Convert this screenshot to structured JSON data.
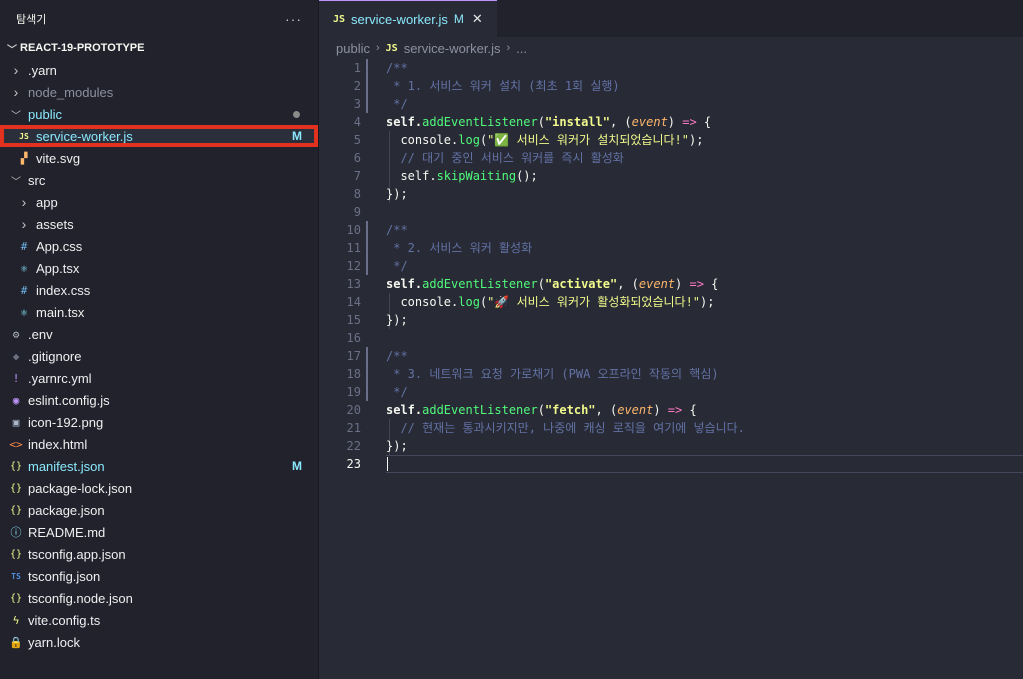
{
  "explorer": {
    "title": "탐색기",
    "more_label": "···",
    "project": "REACT-19-PROTOTYPE",
    "items": [
      {
        "label": ".yarn",
        "kind": "folder-closed",
        "depth": 0
      },
      {
        "label": "node_modules",
        "kind": "folder-closed",
        "depth": 0,
        "dim": true
      },
      {
        "label": "public",
        "kind": "folder-open",
        "depth": 0,
        "modified": true,
        "dot": true
      },
      {
        "label": "service-worker.js",
        "kind": "js",
        "icon": "JS",
        "depth": 1,
        "modified": true,
        "selected": true,
        "badge": "M"
      },
      {
        "label": "vite.svg",
        "kind": "svg",
        "icon": "▞",
        "depth": 1
      },
      {
        "label": "src",
        "kind": "folder-open",
        "depth": 0
      },
      {
        "label": "app",
        "kind": "folder-closed",
        "depth": 1
      },
      {
        "label": "assets",
        "kind": "folder-closed",
        "depth": 1
      },
      {
        "label": "App.css",
        "kind": "css",
        "icon": "#",
        "depth": 1
      },
      {
        "label": "App.tsx",
        "kind": "react",
        "icon": "⚛",
        "depth": 1
      },
      {
        "label": "index.css",
        "kind": "css",
        "icon": "#",
        "depth": 1
      },
      {
        "label": "main.tsx",
        "kind": "react",
        "icon": "⚛",
        "depth": 1
      },
      {
        "label": ".env",
        "kind": "gear",
        "icon": "⚙",
        "depth": 0
      },
      {
        "label": ".gitignore",
        "kind": "git",
        "icon": "◆",
        "depth": 0
      },
      {
        "label": ".yarnrc.yml",
        "kind": "yaml",
        "icon": "!",
        "depth": 0
      },
      {
        "label": "eslint.config.js",
        "kind": "eslint",
        "icon": "◉",
        "depth": 0
      },
      {
        "label": "icon-192.png",
        "kind": "image",
        "icon": "▣",
        "depth": 0
      },
      {
        "label": "index.html",
        "kind": "html",
        "icon": "<>",
        "depth": 0
      },
      {
        "label": "manifest.json",
        "kind": "json",
        "icon": "{}",
        "depth": 0,
        "modified": true,
        "badge": "M"
      },
      {
        "label": "package-lock.json",
        "kind": "json",
        "icon": "{}",
        "depth": 0
      },
      {
        "label": "package.json",
        "kind": "json",
        "icon": "{}",
        "depth": 0
      },
      {
        "label": "README.md",
        "kind": "info",
        "icon": "ⓘ",
        "depth": 0
      },
      {
        "label": "tsconfig.app.json",
        "kind": "json",
        "icon": "{}",
        "depth": 0
      },
      {
        "label": "tsconfig.json",
        "kind": "ts",
        "icon": "TS",
        "depth": 0
      },
      {
        "label": "tsconfig.node.json",
        "kind": "json",
        "icon": "{}",
        "depth": 0
      },
      {
        "label": "vite.config.ts",
        "kind": "vite",
        "icon": "ϟ",
        "depth": 0
      },
      {
        "label": "yarn.lock",
        "kind": "yarn",
        "icon": "🔒",
        "depth": 0
      }
    ]
  },
  "tab": {
    "icon": "JS",
    "label": "service-worker.js",
    "badge": "M",
    "close": "✕"
  },
  "breadcrumb": {
    "folder": "public",
    "sep": "›",
    "icon": "JS",
    "file": "service-worker.js",
    "tail": "..."
  },
  "editor": {
    "current_line": 23,
    "lines": [
      [
        [
          "c",
          "/**"
        ]
      ],
      [
        [
          "c",
          " * 1. 서비스 워커 설치 (최초 1회 실행)"
        ]
      ],
      [
        [
          "c",
          " */"
        ]
      ],
      [
        [
          "p",
          "self."
        ],
        [
          "f",
          "addEventListener"
        ],
        [
          "p",
          "("
        ],
        [
          "s",
          "\"install\""
        ],
        [
          "p",
          ", ("
        ],
        [
          "a",
          "event"
        ],
        [
          "p",
          ") "
        ],
        [
          "k",
          "=>"
        ],
        [
          "p",
          " {"
        ]
      ],
      [
        [
          "p",
          "  console."
        ],
        [
          "f",
          "log"
        ],
        [
          "p",
          "("
        ],
        [
          "s",
          "\"✅ 서비스 워커가 설치되었습니다!\""
        ],
        [
          "p",
          ");"
        ]
      ],
      [
        [
          "c",
          "  // 대기 중인 서비스 워커를 즉시 활성화"
        ]
      ],
      [
        [
          "p",
          "  self."
        ],
        [
          "f",
          "skipWaiting"
        ],
        [
          "p",
          "();"
        ]
      ],
      [
        [
          "p",
          "});"
        ]
      ],
      [],
      [
        [
          "c",
          "/**"
        ]
      ],
      [
        [
          "c",
          " * 2. 서비스 워커 활성화"
        ]
      ],
      [
        [
          "c",
          " */"
        ]
      ],
      [
        [
          "p",
          "self."
        ],
        [
          "f",
          "addEventListener"
        ],
        [
          "p",
          "("
        ],
        [
          "s",
          "\"activate\""
        ],
        [
          "p",
          ", ("
        ],
        [
          "a",
          "event"
        ],
        [
          "p",
          ") "
        ],
        [
          "k",
          "=>"
        ],
        [
          "p",
          " {"
        ]
      ],
      [
        [
          "p",
          "  console."
        ],
        [
          "f",
          "log"
        ],
        [
          "p",
          "("
        ],
        [
          "s",
          "\"🚀 서비스 워커가 활성화되었습니다!\""
        ],
        [
          "p",
          ");"
        ]
      ],
      [
        [
          "p",
          "});"
        ]
      ],
      [],
      [
        [
          "c",
          "/**"
        ]
      ],
      [
        [
          "c",
          " * 3. 네트워크 요청 가로채기 (PWA 오프라인 작동의 핵심)"
        ]
      ],
      [
        [
          "c",
          " */"
        ]
      ],
      [
        [
          "p",
          "self."
        ],
        [
          "f",
          "addEventListener"
        ],
        [
          "p",
          "("
        ],
        [
          "s",
          "\"fetch\""
        ],
        [
          "p",
          ", ("
        ],
        [
          "a",
          "event"
        ],
        [
          "p",
          ") "
        ],
        [
          "k",
          "=>"
        ],
        [
          "p",
          " {"
        ]
      ],
      [
        [
          "c",
          "  // 현재는 통과시키지만, 나중에 캐싱 로직을 여기에 넣습니다."
        ]
      ],
      [
        [
          "p",
          "});"
        ]
      ],
      []
    ]
  },
  "colors": {
    "js_icon": "#f1fa8c",
    "css_icon": "#6eb3e6",
    "react_icon": "#8be9fd",
    "gear_icon": "#aab2c0",
    "git_icon": "#6b6f80",
    "yaml_icon": "#bd93f9",
    "eslint_icon": "#bd93f9",
    "image_icon": "#a9b7c6",
    "html_icon": "#ff8a4c",
    "json_icon": "#f1fa8c",
    "info_icon": "#8be9fd",
    "ts_icon": "#4e8fd8",
    "vite_icon": "#f1fa8c",
    "yarn_icon": "#57a5d8",
    "svg_icon": "#ffb86c",
    "folder": "#c8c8c8"
  }
}
